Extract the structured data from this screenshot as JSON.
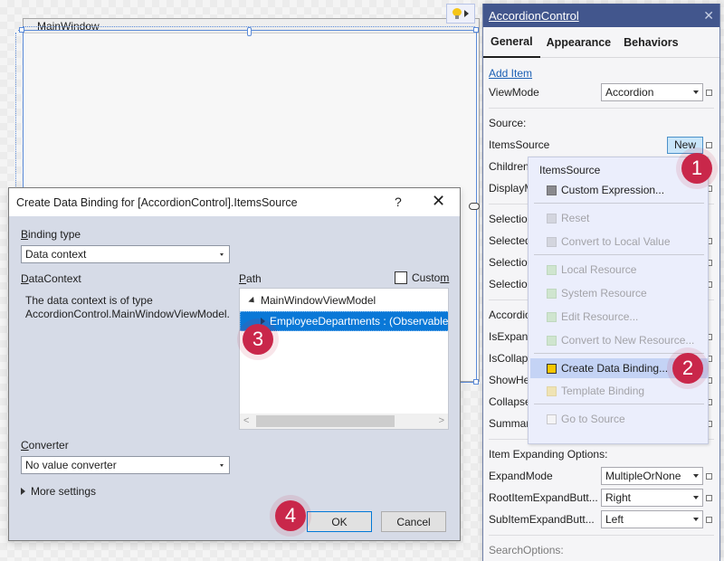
{
  "designer": {
    "window_title": "MainWindow"
  },
  "property_panel": {
    "title": "AccordionControl",
    "tabs": [
      {
        "label": "General",
        "active": true
      },
      {
        "label": "Appearance",
        "active": false
      },
      {
        "label": "Behaviors",
        "active": false
      }
    ],
    "add_item_link": "Add Item",
    "view_mode": {
      "label": "ViewMode",
      "value": "Accordion"
    },
    "source_section": "Source:",
    "items_source": {
      "label": "ItemsSource",
      "button": "New"
    },
    "children_label": "Children",
    "display_label": "DisplayM",
    "selection_rows": [
      "Selectio",
      "Selected",
      "Selectio",
      "Selectio"
    ],
    "accordion_rows": [
      "Accordio",
      "IsExpand",
      "IsCollaps",
      "ShowHe",
      "Collapse",
      "Summar"
    ],
    "expanding_section": "Item Expanding Options:",
    "expand_mode": {
      "label": "ExpandMode",
      "value": "MultipleOrNone"
    },
    "root_item_expand": {
      "label": "RootItemExpandButt...",
      "value": "Right"
    },
    "sub_item_expand": {
      "label": "SubItemExpandButt...",
      "value": "Left"
    },
    "search_section": "SearchOptions:"
  },
  "context_menu": {
    "title": "ItemsSource",
    "items": [
      {
        "label": "Custom Expression...",
        "enabled": true,
        "swatch": "#8a8a8e"
      },
      {
        "label": "Reset",
        "enabled": false,
        "swatch": "#d3d5de"
      },
      {
        "label": "Convert to Local Value",
        "enabled": false,
        "swatch": "#d3d5de"
      },
      {
        "label": "Local Resource",
        "enabled": false,
        "swatch": "#cfe5cf"
      },
      {
        "label": "System Resource",
        "enabled": false,
        "swatch": "#cfe5cf"
      },
      {
        "label": "Edit Resource...",
        "enabled": false,
        "swatch": "#cfe5cf"
      },
      {
        "label": "Convert to New Resource...",
        "enabled": false,
        "swatch": "#cfe5cf"
      },
      {
        "label": "Create Data Binding...",
        "enabled": true,
        "highlighted": true,
        "swatch": "#f7c600"
      },
      {
        "label": "Template Binding",
        "enabled": false,
        "swatch": "#efe3b4"
      },
      {
        "label": "Go to Source",
        "enabled": false,
        "swatch": "#f4f4f6"
      }
    ]
  },
  "dialog": {
    "title": "Create Data Binding for [AccordionControl].ItemsSource",
    "help_label": "?",
    "close_label": "✕",
    "binding_type_label_key": "B",
    "binding_type_label_rest": "inding type",
    "binding_type_value": "Data context",
    "datacontext_label_key": "D",
    "datacontext_label_rest": "ataContext",
    "datacontext_description": "The data context is of type AccordionControl.MainWindowViewModel.",
    "path_label_key": "P",
    "path_label_rest": "ath",
    "custom_label_main": "Custo",
    "custom_label_key": "m",
    "custom_checked": false,
    "tree": {
      "root": "MainWindowViewModel",
      "child": "EmployeeDepartments : (ObservableC"
    },
    "converter_label_key": "C",
    "converter_label_rest": "onverter",
    "converter_value": "No value converter",
    "more_settings": "More settings",
    "ok_label": "OK",
    "cancel_label": "Cancel"
  },
  "badges": [
    "1",
    "2",
    "3",
    "4"
  ]
}
